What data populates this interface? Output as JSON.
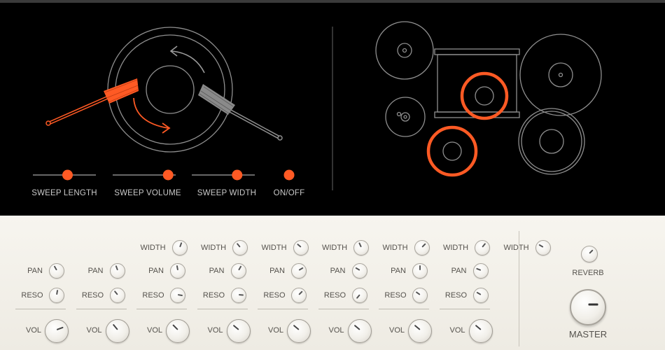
{
  "sweep_controls": {
    "sweep_length": {
      "label": "SWEEP LENGTH",
      "value": 0.55
    },
    "sweep_volume": {
      "label": "SWEEP VOLUME",
      "value": 0.88
    },
    "sweep_width": {
      "label": "SWEEP WIDTH",
      "value": 0.72
    },
    "on_off": {
      "label": "ON/OFF",
      "state": "on"
    }
  },
  "colors": {
    "accent": "#ff5a24",
    "panel_dark": "#000000",
    "panel_light": "#f2f0ea",
    "line": "#8f8f8f"
  },
  "mixer": {
    "labels": {
      "width": "WIDTH",
      "pan": "PAN",
      "reso": "RESO",
      "vol": "VOL"
    },
    "channels": [
      {
        "width": null,
        "pan": -30,
        "reso": 10,
        "vol": 70
      },
      {
        "width": 20,
        "pan": -20,
        "reso": -40,
        "vol": -40
      },
      {
        "width": -40,
        "pan": -10,
        "reso": 100,
        "vol": -45
      },
      {
        "width": -50,
        "pan": 30,
        "reso": 95,
        "vol": -50
      },
      {
        "width": -25,
        "pan": 60,
        "reso": 45,
        "vol": -50
      },
      {
        "width": 45,
        "pan": -60,
        "reso": -140,
        "vol": -50
      },
      {
        "width": 40,
        "pan": 0,
        "reso": -55,
        "vol": -50
      },
      {
        "width": -60,
        "pan": -70,
        "reso": -60,
        "vol": -50
      }
    ]
  },
  "master_section": {
    "reverb": {
      "label": "REVERB",
      "angle": 45
    },
    "master": {
      "label": "MASTER",
      "angle": 90
    }
  },
  "icons": [
    "brush-icon",
    "snare-drum-icon",
    "drum-kit-icon"
  ]
}
